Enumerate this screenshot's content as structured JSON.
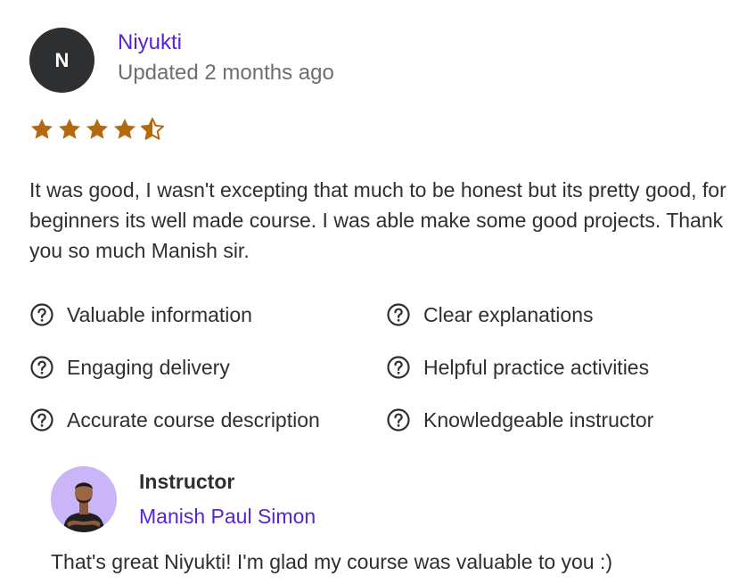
{
  "review": {
    "avatar_initial": "N",
    "reviewer_name": "Niyukti",
    "date": "Updated 2 months ago",
    "rating": 4.5,
    "rating_max": 5,
    "star_color": "#b4690e",
    "text": "It was good, I wasn't excepting that much to be honest but its pretty good, for beginners its well made course. I was able make some good projects. Thank you so much Manish sir."
  },
  "feedback": {
    "icon": "question-circle-icon",
    "items": [
      {
        "label": "Valuable information"
      },
      {
        "label": "Clear explanations"
      },
      {
        "label": "Engaging delivery"
      },
      {
        "label": "Helpful practice activities"
      },
      {
        "label": "Accurate course description"
      },
      {
        "label": "Knowledgeable instructor"
      }
    ]
  },
  "reply": {
    "role": "Instructor",
    "name": "Manish Paul Simon",
    "text": "That's great Niyukti! I'm glad my course was valuable to you :)"
  },
  "colors": {
    "link_purple": "#5624d0",
    "text_dark": "#2d2f31",
    "text_gray": "#6a6f73",
    "avatar_bg": "#2d2f31",
    "instructor_avatar_bg": "#c9b5f7"
  }
}
